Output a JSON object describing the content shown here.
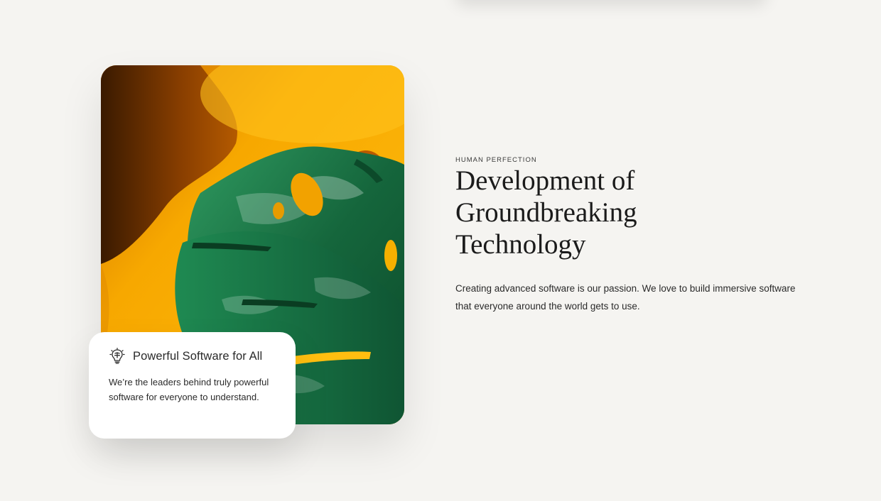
{
  "hero": {
    "eyebrow": "HUMAN PERFECTION",
    "headline_lines": [
      "Development of",
      "Groundbreaking",
      "Technology"
    ],
    "description": "Creating advanced software is our passion. We love to build immersive software that everyone around the world gets to use."
  },
  "feature_card": {
    "icon": "lightbulb-brain-icon",
    "title": "Powerful Software for All",
    "text": "We’re the leaders behind truly powerful software for everyone to understand."
  },
  "image": {
    "subject": "monstera-leaf-photo"
  },
  "colors": {
    "background": "#f5f4f1",
    "image_yellow": "#f9b100",
    "leaf_green": "#1f7a4d",
    "card_white": "#ffffff",
    "text_dark": "#1b1b1b"
  }
}
